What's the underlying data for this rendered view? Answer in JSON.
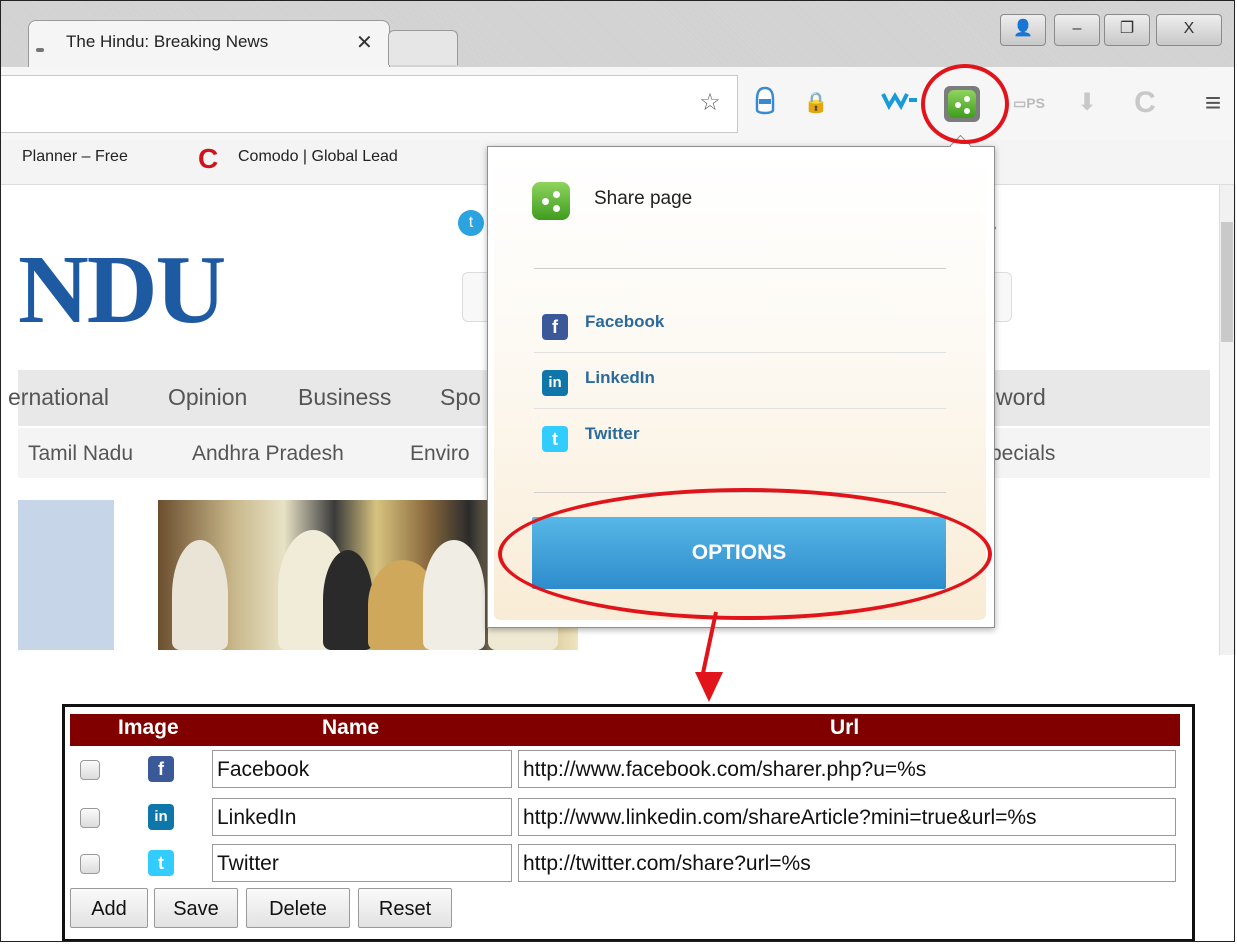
{
  "browser": {
    "tab_title": "The Hindu: Breaking News",
    "tab_close": "✕",
    "window_buttons": {
      "user": "👤",
      "minimize": "–",
      "restore": "❐",
      "close": "X"
    },
    "toolbar_icons": [
      "star-icon",
      "tag-icon",
      "lock-icon",
      "wot-icon",
      "sharepage-icon",
      "ips-icon",
      "download-icon",
      "comodo-icon",
      "menu-icon"
    ]
  },
  "bookmarks": [
    {
      "label": "Planner – Free"
    },
    {
      "label": "Comodo | Global Lead"
    }
  ],
  "page": {
    "logo": "NDU",
    "nav_main": [
      "ernational",
      "Opinion",
      "Business",
      "Spo",
      "word"
    ],
    "nav_sub": [
      "Tamil Nadu",
      "Andhra Pradesh",
      "Enviro",
      "pecials"
    ]
  },
  "popup": {
    "share_label": "Share page",
    "networks": [
      {
        "name": "Facebook",
        "icon": "facebook-icon",
        "glyph": "f",
        "color": "#3b5998"
      },
      {
        "name": "LinkedIn",
        "icon": "linkedin-icon",
        "glyph": "in",
        "color": "#0e76a8"
      },
      {
        "name": "Twitter",
        "icon": "twitter-icon",
        "glyph": "t",
        "color": "#33ccff"
      }
    ],
    "options_label": "OPTIONS"
  },
  "options_table": {
    "headers": {
      "image": "Image",
      "name": "Name",
      "url": "Url"
    },
    "rows": [
      {
        "name": "Facebook",
        "url": "http://www.facebook.com/sharer.php?u=%s",
        "glyph": "f",
        "color": "#3b5998"
      },
      {
        "name": "LinkedIn",
        "url": "http://www.linkedin.com/shareArticle?mini=true&url=%s",
        "glyph": "in",
        "color": "#0e76a8"
      },
      {
        "name": "Twitter",
        "url": "http://twitter.com/share?url=%s",
        "glyph": "t",
        "color": "#33ccff"
      }
    ],
    "buttons": {
      "add": "Add",
      "save": "Save",
      "delete": "Delete",
      "reset": "Reset"
    }
  },
  "colors": {
    "accent_red": "#e0141a",
    "table_header": "#800000",
    "options_button": "#2d8ccc"
  }
}
